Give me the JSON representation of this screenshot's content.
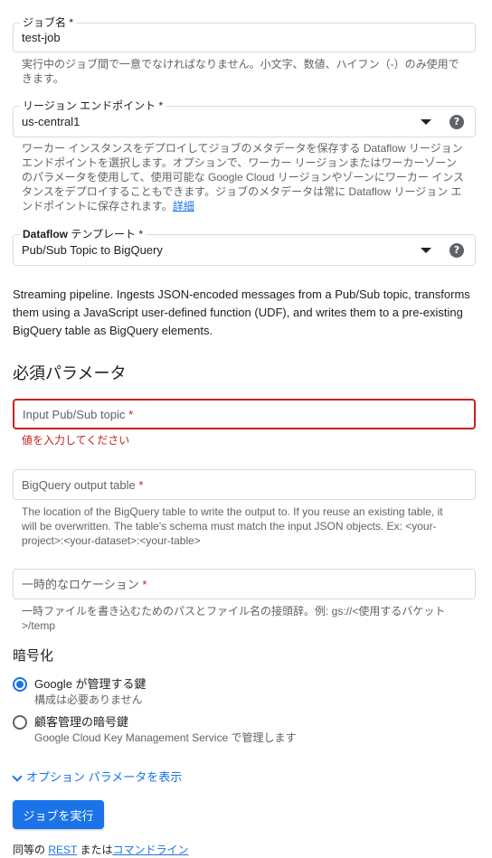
{
  "job_name": {
    "label": "ジョブ名",
    "required_mark": "*",
    "value": "test-job",
    "hint": "実行中のジョブ間で一意でなければなりません。小文字、数値、ハイフン（-）のみ使用できます。"
  },
  "region": {
    "label": "リージョン エンドポイント",
    "required_mark": "*",
    "value": "us-central1",
    "help_icon": "help-circle-icon",
    "hint": "ワーカー インスタンスをデプロイしてジョブのメタデータを保存する Dataflow リージョン エンドポイントを選択します。オプションで、ワーカー リージョンまたはワーカーゾーンのパラメータを使用して、使用可能な Google Cloud リージョンやゾーンにワーカー インスタンスをデプロイすることもできます。ジョブのメタデータは常に Dataflow リージョン エンドポイントに保存されます。",
    "hint_link": "詳細"
  },
  "template": {
    "label_bold": "Dataflow",
    "label_rest": " テンプレート",
    "required_mark": "*",
    "value": "Pub/Sub Topic to BigQuery",
    "help_icon": "help-circle-icon"
  },
  "template_description": "Streaming pipeline. Ingests JSON-encoded messages from a Pub/Sub topic, transforms them using a JavaScript user-defined function (UDF), and writes them to a pre-existing BigQuery table as BigQuery elements.",
  "required_params": {
    "title": "必須パラメータ",
    "input_topic": {
      "placeholder": "Input Pub/Sub topic",
      "required_mark": "*",
      "error": "値を入力してください"
    },
    "output_table": {
      "placeholder": "BigQuery output table",
      "required_mark": "*",
      "hint": "The location of the BigQuery table to write the output to. If you reuse an existing table, it will be overwritten. The table's schema must match the input JSON objects. Ex: <your-project>:<your-dataset>:<your-table>"
    },
    "temp_location": {
      "placeholder": "一時的なロケーション",
      "required_mark": "*",
      "hint": "一時ファイルを書き込むためのパスとファイル名の接頭辞。例: gs://<使用するバケット>/temp"
    }
  },
  "encryption": {
    "title": "暗号化",
    "options": [
      {
        "label": "Google が管理する鍵",
        "sub": "構成は必要ありません",
        "selected": true
      },
      {
        "label": "顧客管理の暗号鍵",
        "sub": "Google Cloud Key Management Service で管理します",
        "selected": false
      }
    ]
  },
  "optional_toggle": "オプション パラメータを表示",
  "run_button": "ジョブを実行",
  "equivalent": {
    "prefix": "同等の ",
    "rest": "REST",
    "middle": " または",
    "cli": "コマンドライン"
  },
  "colors": {
    "accent": "#1a73e8",
    "error": "#c5221f",
    "text": "#202124",
    "secondary": "#5f6368",
    "border": "#dadce0"
  }
}
